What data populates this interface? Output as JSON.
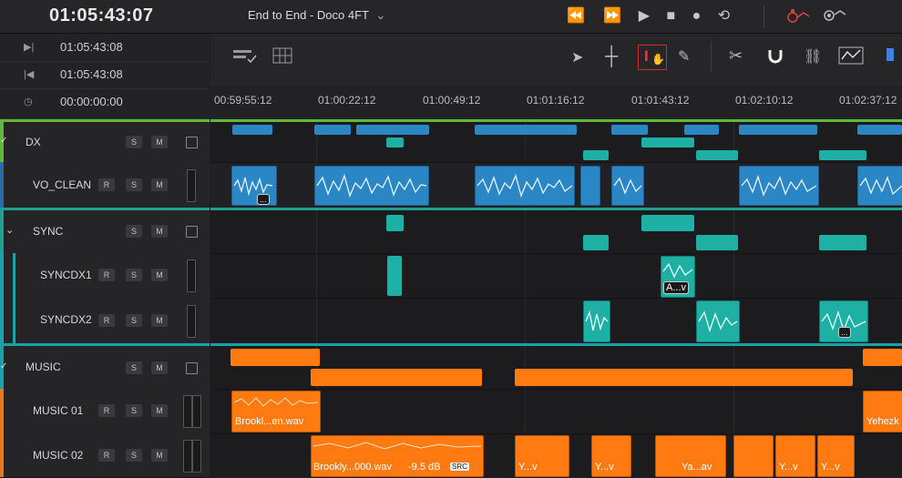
{
  "topbar": {
    "timecode": "01:05:43:07",
    "project_title": "End to End - Doco 4FT",
    "dropdown_glyph": "⌄",
    "transport": [
      "⏪",
      "⏩",
      "▶",
      "■",
      "●",
      "⟲"
    ],
    "right_icons": [
      "automation-icon",
      "settings-icon"
    ]
  },
  "timecodes": [
    {
      "icon": "▶|",
      "value": "01:05:43:08"
    },
    {
      "icon": "|◀",
      "value": "01:05:43:08"
    },
    {
      "icon": "◷",
      "value": "00:00:00:00"
    }
  ],
  "ruler": [
    "00:59:55:12",
    "01:00:22:12",
    "01:00:49:12",
    "01:01:16:12",
    "01:01:43:12",
    "01:02:10:12",
    "01:02:37:12"
  ],
  "tracks": [
    {
      "name": "DX",
      "color": "#5fb83a",
      "is_bus": true
    },
    {
      "name": "VO_CLEAN",
      "color": "#2a6aa8",
      "is_bus": false
    },
    {
      "name": "SYNC",
      "color": "#20a08f",
      "is_bus": true
    },
    {
      "name": "SYNCDX1",
      "color": "#1aa3a8",
      "is_bus": false
    },
    {
      "name": "SYNCDX2",
      "color": "#1aa3a8",
      "is_bus": false
    },
    {
      "name": "MUSIC",
      "color": "#19a3a8",
      "is_bus": true
    },
    {
      "name": "MUSIC 01",
      "color": "#e8781a",
      "is_bus": false
    },
    {
      "name": "MUSIC 02",
      "color": "#e8781a",
      "is_bus": false
    }
  ],
  "buttons": {
    "r": "R",
    "s": "S",
    "m": "M"
  },
  "clips": {
    "vo_more": "...",
    "syncdx1_label": "A...v",
    "syncdx2_more": "...",
    "music01_a": "Brookl...en.wav",
    "music01_b": "Yehezk",
    "music02_a": "Brookly...000.wav",
    "music02_gain": "-9.5 dB",
    "music02_src": "SRC",
    "music02_b": "Y...v",
    "music02_c": "Y...v",
    "music02_d": "Ya...av",
    "music02_e": "Y...v",
    "music02_f": "Y...v"
  },
  "colors": {
    "dx": "#2a86c4",
    "sync": "#1fb0a5",
    "music": "#ff7a10"
  }
}
